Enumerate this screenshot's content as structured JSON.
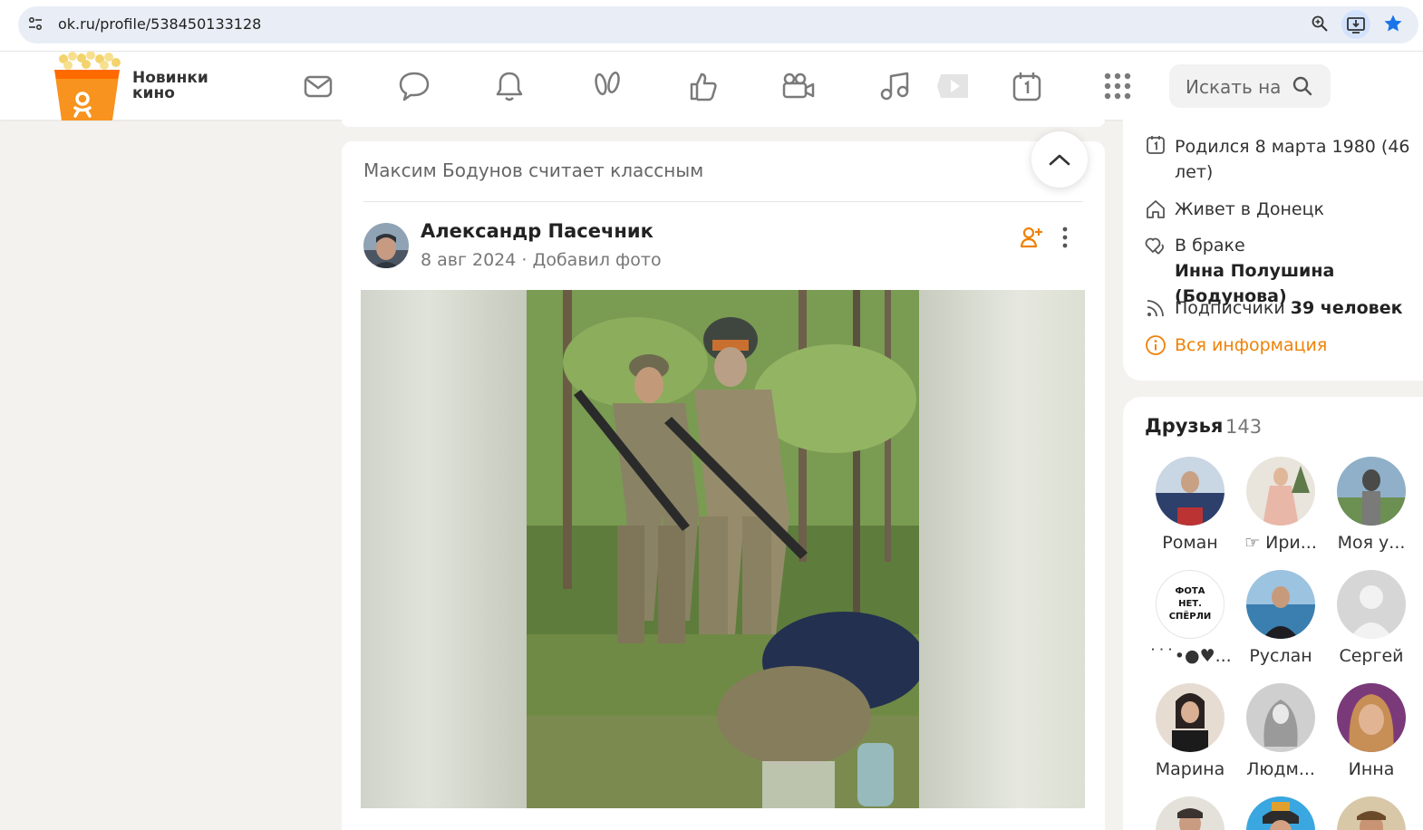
{
  "browser": {
    "url": "ok.ru/profile/538450133128"
  },
  "header": {
    "promo_text": "Новинки кино",
    "nav_icons": [
      "mail-icon",
      "discussions-icon",
      "notifications-icon",
      "guests-icon",
      "likes-icon",
      "video-icon",
      "music-icon",
      "video-play-icon",
      "calendar-icon",
      "apps-grid-icon"
    ],
    "search_placeholder": "Искать на",
    "accent_color": "#ee8208"
  },
  "feed": {
    "liker_line": "Максим Бодунов считает классным",
    "post": {
      "author": "Александр Пасечник",
      "date": "8 авг 2024",
      "separator": "·",
      "action": "Добавил фото"
    }
  },
  "profile_info": {
    "birthday_line1": "Родился 8 марта 1980 (46",
    "birthday_line2": "лет)",
    "lives_in": "Живет в Донецк",
    "marital_status": "В браке",
    "spouse": "Инна Полушина (Бодунова)",
    "subscribers_label": "Подписчики",
    "subscribers_count": "39 человек",
    "all_info_link": "Вся информация"
  },
  "friends": {
    "title": "Друзья",
    "count": "143",
    "items": [
      {
        "name": "Роман"
      },
      {
        "name": "☞ Ири..."
      },
      {
        "name": "Моя у..."
      },
      {
        "name": "˙˙˙•●♥..."
      },
      {
        "name": "Руслан"
      },
      {
        "name": "Сергей"
      },
      {
        "name": "Марина"
      },
      {
        "name": "Людм..."
      },
      {
        "name": "Инна"
      }
    ],
    "placeholder_avatar_text": "ФОТА НЕТ. СПЁРЛИ"
  }
}
